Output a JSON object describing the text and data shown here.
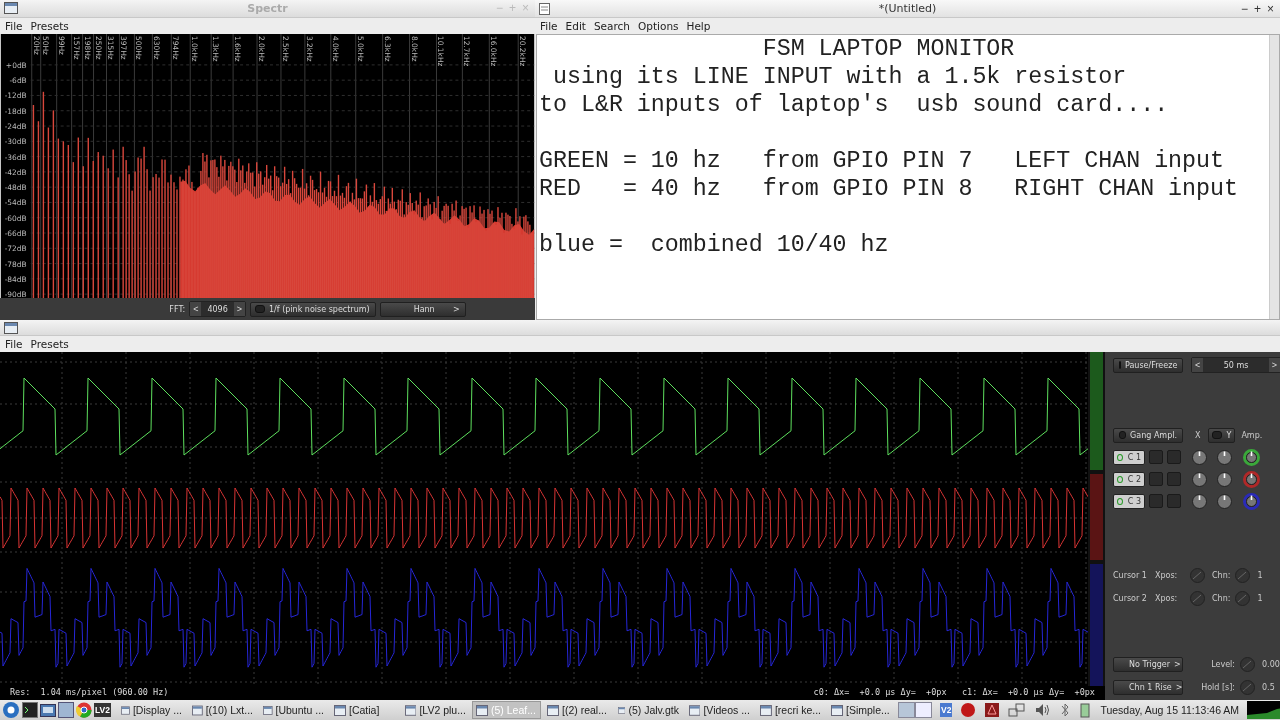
{
  "spectr_window": {
    "title": "Spectr",
    "active": false,
    "controls": [
      "−",
      "+",
      "×"
    ],
    "menu": [
      "File",
      "Presets"
    ],
    "freq_labels": [
      "20Hz",
      "50Hz",
      "99Hz",
      "157Hz",
      "198Hz",
      "250Hz",
      "315Hz",
      "397Hz",
      "500Hz",
      "630Hz",
      "794Hz",
      "1.0kHz",
      "1.3kHz",
      "1.6kHz",
      "2.0kHz",
      "2.5kHz",
      "3.2kHz",
      "4.0kHz",
      "5.0kHz",
      "6.3kHz",
      "8.0kHz",
      "10.1kHz",
      "12.7kHz",
      "16.0kHz",
      "20.2kHz"
    ],
    "db_labels": [
      "+0dB",
      "-6dB",
      "-12dB",
      "-18dB",
      "-24dB",
      "-30dB",
      "-36dB",
      "-42dB",
      "-48dB",
      "-54dB",
      "-60dB",
      "-66dB",
      "-72dB",
      "-78dB",
      "-84dB",
      "-90dB"
    ],
    "fft_label": "FFT:",
    "fft_prev": "<",
    "fft_size": "4096",
    "fft_next": ">",
    "weighting": "1/f (pink noise spectrum)",
    "weighting_on": false,
    "window_fn": "Hann",
    "window_next": ">"
  },
  "editor": {
    "title": "*(Untitled)",
    "active": true,
    "controls": [
      "−",
      "+",
      "×"
    ],
    "menu": [
      "File",
      "Edit",
      "Search",
      "Options",
      "Help"
    ],
    "blocks": [
      [
        "                FSM LAPTOP MONITOR",
        " using its LINE INPUT with a 1.5k resistor",
        "to L&R inputs of laptop's  usb sound card...."
      ],
      [
        "GREEN = 10 hz   from GPIO PIN 7   LEFT CHAN input",
        "RED   = 40 hz   from GPIO PIN 8   RIGHT CHAN input"
      ],
      [
        "blue =  combined 10/40 hz"
      ]
    ]
  },
  "scope": {
    "menu": [
      "File",
      "Presets"
    ],
    "traces": [
      {
        "color": "#5ee05e"
      },
      {
        "color": "#d83434"
      },
      {
        "color": "#2626d8"
      }
    ],
    "status": {
      "res_label": "Res:",
      "res": "1.04 ms/pixel (960.00 Hz)",
      "readout": "c0: Δx=  +0.0 µs Δy=  +0px   c1: Δx=  +0.0 µs Δy=  +0px"
    },
    "panel": {
      "pause": "Pause/Freeze",
      "pause_on": false,
      "time_prev": "<",
      "timebase": "50 ms",
      "time_next": ">",
      "gang": "Gang Ampl.",
      "gang_on": false,
      "x_label": "X",
      "y_toggle": "Y",
      "y_on": false,
      "amp_label": "Amp.",
      "channels": [
        {
          "label": "C 1",
          "enabled": true,
          "color": "#3aa83a"
        },
        {
          "label": "C 2",
          "enabled": true,
          "color": "#b02828"
        },
        {
          "label": "C 3",
          "enabled": true,
          "color": "#2a2ab8"
        }
      ],
      "cursors": [
        {
          "label": "Cursor 1",
          "xpos": "Xpos:",
          "chn_label": "Chn:",
          "chn": "1"
        },
        {
          "label": "Cursor 2",
          "xpos": "Xpos:",
          "chn_label": "Chn:",
          "chn": "1"
        }
      ],
      "trigger": "No Trigger",
      "trigger_next": ">",
      "level_label": "Level:",
      "level": "0.00",
      "edge": "Chn 1 Rise",
      "edge_next": ">",
      "hold_label": "Hold [s]:",
      "hold": "0.5"
    }
  },
  "taskbar": {
    "launchers": [
      {
        "kind": "menu"
      },
      {
        "kind": "terminal"
      },
      {
        "kind": "files"
      },
      {
        "kind": "window"
      },
      {
        "kind": "browser"
      },
      {
        "kind": "logo",
        "text": "LV2"
      }
    ],
    "tasks": [
      {
        "label": "[Display ...",
        "selected": false
      },
      {
        "label": "[(10) Lxt...",
        "selected": false
      },
      {
        "label": "[Ubuntu ...",
        "selected": false
      },
      {
        "label": "[Catia]",
        "selected": false
      },
      {
        "label": "[LV2 plu...",
        "selected": false
      },
      {
        "label": "(5) Leaf...",
        "selected": true
      },
      {
        "label": "[(2) real...",
        "selected": false
      },
      {
        "label": "(5) Jalv.gtk",
        "selected": false
      },
      {
        "label": "[Videos ...",
        "selected": false
      },
      {
        "label": "[recri ke...",
        "selected": false
      },
      {
        "label": "[Simple...",
        "selected": false
      }
    ],
    "tray": [
      {
        "kind": "pager"
      },
      {
        "kind": "logo",
        "text": "V2"
      },
      {
        "kind": "record"
      },
      {
        "kind": "app"
      },
      {
        "kind": "network"
      },
      {
        "kind": "volume"
      },
      {
        "kind": "bluetooth"
      },
      {
        "kind": "power"
      }
    ],
    "clock": "Tuesday, Aug 15 11:13:46 AM"
  }
}
